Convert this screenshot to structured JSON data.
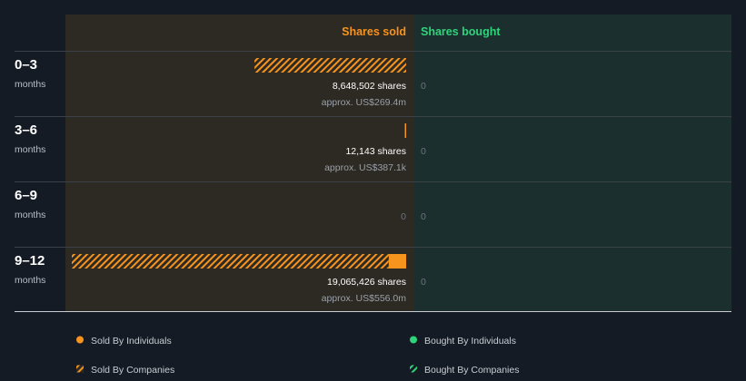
{
  "colors": {
    "background": "#151b24",
    "sold_panel": "#2d2923",
    "bought_panel": "#1b2f2f",
    "sold": "#f7941d",
    "bought": "#2ed47a",
    "divider": "#3b4148",
    "zero_text": "#6d7480"
  },
  "chart_data": {
    "type": "bar",
    "orientation": "horizontal",
    "stacked": true,
    "columns": {
      "sold": "Shares sold",
      "bought": "Shares bought"
    },
    "categories": [
      {
        "period": "0–3",
        "unit": "months"
      },
      {
        "period": "3–6",
        "unit": "months"
      },
      {
        "period": "6–9",
        "unit": "months"
      },
      {
        "period": "9–12",
        "unit": "months"
      }
    ],
    "sold_by_individuals": [
      0,
      12143,
      0,
      1000000
    ],
    "sold_by_companies": [
      8648502,
      0,
      0,
      18065426
    ],
    "bought_by_individuals": [
      0,
      0,
      0,
      0
    ],
    "bought_by_companies": [
      0,
      0,
      0,
      0
    ],
    "sold_total_labels": [
      "8,648,502 shares",
      "12,143 shares",
      "0",
      "19,065,426 shares"
    ],
    "sold_value_labels": [
      "approx. US$269.4m",
      "approx. US$387.1k",
      "",
      "approx. US$556.0m"
    ],
    "bought_labels": [
      "0",
      "0",
      "0",
      "0"
    ],
    "scale_max": 19065426,
    "legend": [
      {
        "label": "Sold By Individuals",
        "color": "#f7941d",
        "style": "solid"
      },
      {
        "label": "Bought By Individuals",
        "color": "#2ed47a",
        "style": "solid"
      },
      {
        "label": "Sold By Companies",
        "color": "#f7941d",
        "style": "hatched"
      },
      {
        "label": "Bought By Companies",
        "color": "#2ed47a",
        "style": "hatched"
      }
    ]
  }
}
